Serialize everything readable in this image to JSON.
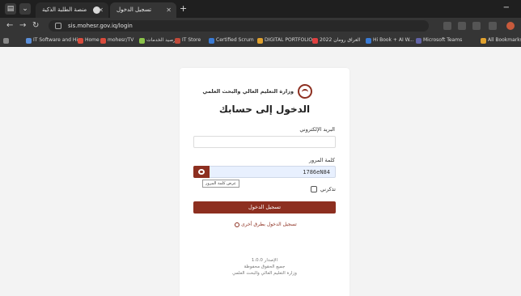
{
  "browser": {
    "tabs": [
      {
        "title": "منصة الطلبة الذكية",
        "active": false
      },
      {
        "title": "تسجيل الدخول",
        "active": true
      }
    ],
    "new_tab": "+",
    "minimize": "−",
    "omnibox": {
      "url": "sis.mohesr.gov.iq/login"
    },
    "bookmarks": [
      {
        "label": "IT Software and Hir...",
        "color": "#5b8fd9"
      },
      {
        "label": "Home",
        "color": "#d94b3c"
      },
      {
        "label": "mohesr/TV",
        "color": "#d94b3c"
      },
      {
        "label": "رصيد الخدمات",
        "color": "#8bc34a"
      },
      {
        "label": "IT Store",
        "color": "#c04a3a"
      },
      {
        "label": "Certified Scrum",
        "color": "#3a7bd5"
      },
      {
        "label": "DIGITAL PORTFOLIO",
        "color": "#e0a12e"
      },
      {
        "label": "العراق رومان 2022",
        "color": "#e04040"
      },
      {
        "label": "Hi Book + AI W...",
        "color": "#3a7bd5"
      },
      {
        "label": "Microsoft Teams",
        "color": "#6264a7"
      },
      {
        "label": "All Bookmarks",
        "color": "#e0a12e"
      }
    ]
  },
  "login": {
    "ministry_name": "وزارة التعليم العالي والبحث العلمي",
    "title": "الدخول إلى حسابك",
    "email_label": "البريد الإلكتروني",
    "email_value": "",
    "password_label": "كلمة المرور",
    "password_value": "1786eN84",
    "show_password_tooltip": "عرض كلمة المرور",
    "remember_label": "تذكرني",
    "submit_label": "تسجيل الدخول",
    "alt_login_label": "تسجيل الدخول بطرق أخرى",
    "footer_lines": [
      "الإصدار 1.0.0",
      "جميع الحقوق محفوظة",
      "وزارة التعليم العالي والبحث العلمي"
    ]
  },
  "colors": {
    "accent": "#8d2f20",
    "page_bg": "#f3f3f3",
    "chrome_dark": "#1f1f1f"
  }
}
